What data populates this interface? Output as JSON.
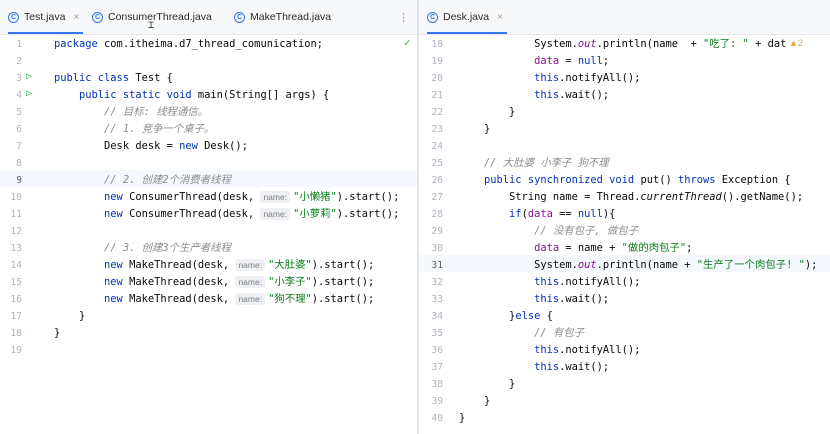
{
  "left": {
    "tabs": [
      {
        "label": "Test.java",
        "active": true
      },
      {
        "label": "ConsumerThread.java",
        "active": false
      },
      {
        "label": "MakeThread.java",
        "active": false
      }
    ],
    "menu_label": "⋮",
    "lines": [
      {
        "n": "1",
        "p": [
          [
            "kw",
            "package "
          ],
          [
            "pkg",
            "com.itheima.d7_thread_comunication;"
          ]
        ]
      },
      {
        "n": "2",
        "p": []
      },
      {
        "n": "3",
        "run": true,
        "p": [
          [
            "kw",
            "public class "
          ],
          [
            "pkg",
            "Test {"
          ]
        ]
      },
      {
        "n": "4",
        "run": true,
        "p": [
          [
            "pkg",
            "    "
          ],
          [
            "kw",
            "public static void "
          ],
          [
            "pkg",
            "main(String[] args) {"
          ]
        ]
      },
      {
        "n": "5",
        "p": [
          [
            "pkg",
            "        "
          ],
          [
            "cm",
            "// 目标: 线程通信。"
          ]
        ]
      },
      {
        "n": "6",
        "p": [
          [
            "pkg",
            "        "
          ],
          [
            "cm",
            "// 1. 竞争一个桌子。"
          ]
        ]
      },
      {
        "n": "7",
        "p": [
          [
            "pkg",
            "        Desk desk = "
          ],
          [
            "kw",
            "new "
          ],
          [
            "pkg",
            "Desk();"
          ]
        ]
      },
      {
        "n": "8",
        "p": []
      },
      {
        "n": "9",
        "cur": true,
        "p": [
          [
            "pkg",
            "        "
          ],
          [
            "cm",
            "// 2. 创建2个消费者线程"
          ]
        ]
      },
      {
        "n": "10",
        "p": [
          [
            "pkg",
            "        "
          ],
          [
            "kw",
            "new "
          ],
          [
            "pkg",
            "ConsumerThread(desk, "
          ],
          [
            "hint",
            "name:"
          ],
          [
            "str",
            "\"小懒猪\""
          ],
          [
            "pkg",
            ").start();"
          ]
        ]
      },
      {
        "n": "11",
        "p": [
          [
            "pkg",
            "        "
          ],
          [
            "kw",
            "new "
          ],
          [
            "pkg",
            "ConsumerThread(desk, "
          ],
          [
            "hint",
            "name:"
          ],
          [
            "str",
            "\"小萝莉\""
          ],
          [
            "pkg",
            ").start();"
          ]
        ]
      },
      {
        "n": "12",
        "p": []
      },
      {
        "n": "13",
        "p": [
          [
            "pkg",
            "        "
          ],
          [
            "cm",
            "// 3. 创建3个生产者线程"
          ]
        ]
      },
      {
        "n": "14",
        "p": [
          [
            "pkg",
            "        "
          ],
          [
            "kw",
            "new "
          ],
          [
            "pkg",
            "MakeThread(desk, "
          ],
          [
            "hint",
            "name:"
          ],
          [
            "str",
            "\"大肚婆\""
          ],
          [
            "pkg",
            ").start();"
          ]
        ]
      },
      {
        "n": "15",
        "p": [
          [
            "pkg",
            "        "
          ],
          [
            "kw",
            "new "
          ],
          [
            "pkg",
            "MakeThread(desk, "
          ],
          [
            "hint",
            "name:"
          ],
          [
            "str",
            "\"小李子\""
          ],
          [
            "pkg",
            ").start();"
          ]
        ]
      },
      {
        "n": "16",
        "p": [
          [
            "pkg",
            "        "
          ],
          [
            "kw",
            "new "
          ],
          [
            "pkg",
            "MakeThread(desk, "
          ],
          [
            "hint",
            "name:"
          ],
          [
            "str",
            "\"狗不理\""
          ],
          [
            "pkg",
            ").start();"
          ]
        ]
      },
      {
        "n": "17",
        "p": [
          [
            "pkg",
            "    }"
          ]
        ]
      },
      {
        "n": "18",
        "p": [
          [
            "pkg",
            "}"
          ]
        ]
      },
      {
        "n": "19",
        "p": []
      }
    ]
  },
  "right": {
    "tabs": [
      {
        "label": "Desk.java",
        "active": true
      }
    ],
    "warning_count": "2",
    "lines": [
      {
        "n": "18",
        "p": [
          [
            "pkg",
            "            System."
          ],
          [
            "ital",
            "out"
          ],
          [
            "pkg",
            ".println(name  + "
          ],
          [
            "str",
            "\"吃了: \""
          ],
          [
            "pkg",
            " + dat"
          ]
        ]
      },
      {
        "n": "19",
        "p": [
          [
            "pkg",
            "            "
          ],
          [
            "fld",
            "data"
          ],
          [
            "pkg",
            " = "
          ],
          [
            "kw",
            "null"
          ],
          [
            "pkg",
            ";"
          ]
        ]
      },
      {
        "n": "20",
        "p": [
          [
            "pkg",
            "            "
          ],
          [
            "kw",
            "this"
          ],
          [
            "pkg",
            ".notifyAll();"
          ]
        ]
      },
      {
        "n": "21",
        "p": [
          [
            "pkg",
            "            "
          ],
          [
            "kw",
            "this"
          ],
          [
            "pkg",
            ".wait();"
          ]
        ]
      },
      {
        "n": "22",
        "p": [
          [
            "pkg",
            "        }"
          ]
        ]
      },
      {
        "n": "23",
        "p": [
          [
            "pkg",
            "    }"
          ]
        ]
      },
      {
        "n": "24",
        "p": []
      },
      {
        "n": "25",
        "p": [
          [
            "pkg",
            "    "
          ],
          [
            "cm",
            "// 大肚婆 小李子 狗不理"
          ]
        ]
      },
      {
        "n": "26",
        "p": [
          [
            "pkg",
            "    "
          ],
          [
            "kw",
            "public synchronized void "
          ],
          [
            "pkg",
            "put() "
          ],
          [
            "kw",
            "throws "
          ],
          [
            "pkg",
            "Exception {"
          ]
        ]
      },
      {
        "n": "27",
        "p": [
          [
            "pkg",
            "        String name = Thread."
          ],
          [
            "it",
            "currentThread"
          ],
          [
            "pkg",
            "().getName();"
          ]
        ]
      },
      {
        "n": "28",
        "p": [
          [
            "pkg",
            "        "
          ],
          [
            "kw",
            "if"
          ],
          [
            "pkg",
            "("
          ],
          [
            "fld",
            "data"
          ],
          [
            "pkg",
            " == "
          ],
          [
            "kw",
            "null"
          ],
          [
            "pkg",
            "){"
          ]
        ]
      },
      {
        "n": "29",
        "p": [
          [
            "pkg",
            "            "
          ],
          [
            "cm",
            "// 没有包子, 做包子"
          ]
        ]
      },
      {
        "n": "30",
        "p": [
          [
            "pkg",
            "            "
          ],
          [
            "fld",
            "data"
          ],
          [
            "pkg",
            " = name + "
          ],
          [
            "str",
            "\"做的肉包子\""
          ],
          [
            "pkg",
            ";"
          ]
        ]
      },
      {
        "n": "31",
        "cur": true,
        "p": [
          [
            "pkg",
            "            System."
          ],
          [
            "ital",
            "out"
          ],
          [
            "pkg",
            ".println(name + "
          ],
          [
            "str",
            "\"生产了一个肉包子! \""
          ],
          [
            "pkg",
            ");"
          ]
        ]
      },
      {
        "n": "32",
        "p": [
          [
            "pkg",
            "            "
          ],
          [
            "kw",
            "this"
          ],
          [
            "pkg",
            ".notifyAll();"
          ]
        ]
      },
      {
        "n": "33",
        "p": [
          [
            "pkg",
            "            "
          ],
          [
            "kw",
            "this"
          ],
          [
            "pkg",
            ".wait();"
          ]
        ]
      },
      {
        "n": "34",
        "p": [
          [
            "pkg",
            "        }"
          ],
          [
            "kw",
            "else "
          ],
          [
            "pkg",
            "{"
          ]
        ]
      },
      {
        "n": "35",
        "p": [
          [
            "pkg",
            "            "
          ],
          [
            "cm",
            "// 有包子"
          ]
        ]
      },
      {
        "n": "36",
        "p": [
          [
            "pkg",
            "            "
          ],
          [
            "kw",
            "this"
          ],
          [
            "pkg",
            ".notifyAll();"
          ]
        ]
      },
      {
        "n": "37",
        "p": [
          [
            "pkg",
            "            "
          ],
          [
            "kw",
            "this"
          ],
          [
            "pkg",
            ".wait();"
          ]
        ]
      },
      {
        "n": "38",
        "p": [
          [
            "pkg",
            "        }"
          ]
        ]
      },
      {
        "n": "39",
        "p": [
          [
            "pkg",
            "    }"
          ]
        ]
      },
      {
        "n": "40",
        "p": [
          [
            "pkg",
            "}"
          ]
        ]
      }
    ]
  },
  "colors": {
    "keyword": "#0033b3",
    "string": "#067d17",
    "comment": "#8c8c8c",
    "field": "#871094",
    "accent": "#3574f0"
  },
  "icons": [
    "java-class-icon",
    "close-icon",
    "run-icon",
    "check-icon",
    "warning-icon",
    "more-menu-icon"
  ]
}
